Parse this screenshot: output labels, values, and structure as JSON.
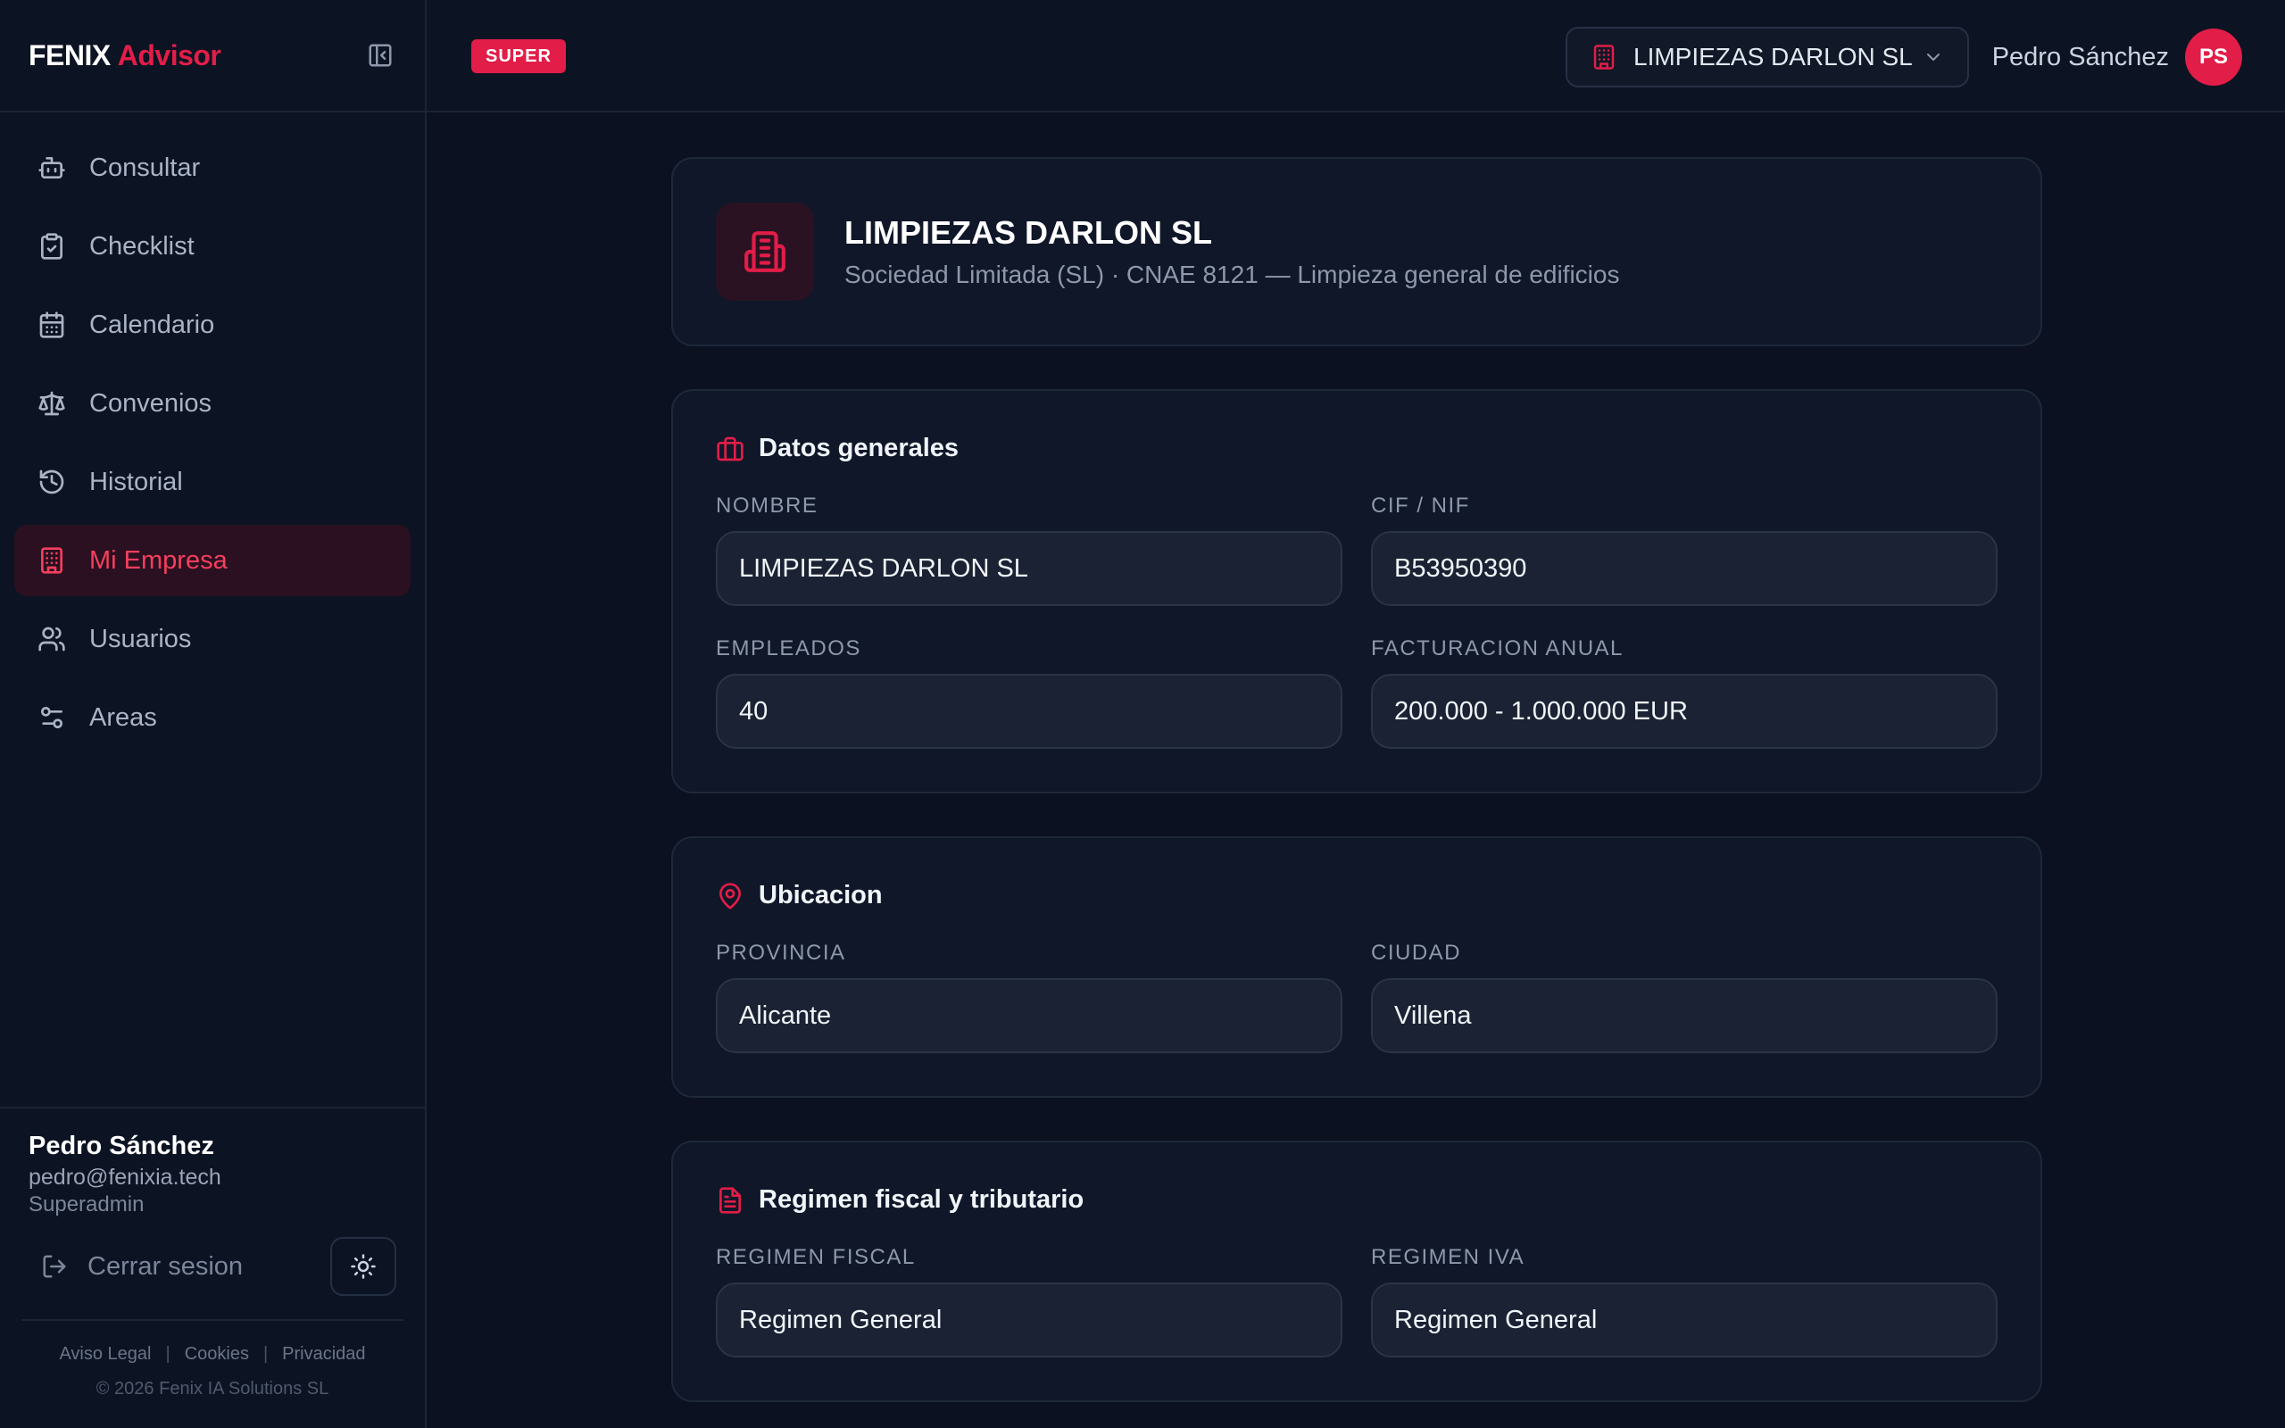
{
  "brand": {
    "part1": "FENIX",
    "part2": "Advisor"
  },
  "sidebar": {
    "items": [
      {
        "label": "Consultar"
      },
      {
        "label": "Checklist"
      },
      {
        "label": "Calendario"
      },
      {
        "label": "Convenios"
      },
      {
        "label": "Historial"
      },
      {
        "label": "Mi Empresa",
        "active": true
      },
      {
        "label": "Usuarios"
      },
      {
        "label": "Areas"
      }
    ],
    "user": {
      "name": "Pedro Sánchez",
      "email": "pedro@fenixia.tech",
      "role": "Superadmin"
    },
    "logout_label": "Cerrar sesion",
    "legal": {
      "aviso": "Aviso Legal",
      "cookies": "Cookies",
      "privacidad": "Privacidad"
    },
    "copyright": "© 2026 Fenix IA Solutions SL"
  },
  "topbar": {
    "badge": "SUPER",
    "company": "LIMPIEZAS DARLON SL",
    "user_name": "Pedro Sánchez",
    "user_initials": "PS"
  },
  "company": {
    "name": "LIMPIEZAS DARLON SL",
    "subtitle": "Sociedad Limitada (SL) · CNAE 8121 — Limpieza general de edificios"
  },
  "sections": {
    "general": {
      "title": "Datos generales",
      "nombre_label": "NOMBRE",
      "nombre": "LIMPIEZAS DARLON SL",
      "cif_label": "CIF / NIF",
      "cif": "B53950390",
      "empleados_label": "EMPLEADOS",
      "empleados": "40",
      "facturacion_label": "FACTURACION ANUAL",
      "facturacion": "200.000 - 1.000.000 EUR"
    },
    "ubicacion": {
      "title": "Ubicacion",
      "provincia_label": "PROVINCIA",
      "provincia": "Alicante",
      "ciudad_label": "CIUDAD",
      "ciudad": "Villena"
    },
    "fiscal": {
      "title": "Regimen fiscal y tributario",
      "fiscal_label": "REGIMEN FISCAL",
      "fiscal": "Regimen General",
      "iva_label": "REGIMEN IVA",
      "iva": "Regimen General"
    }
  },
  "colors": {
    "accent": "#e11d48",
    "background": "#0b1120",
    "card": "#0f1729"
  },
  "icons": [
    "panel-collapse-icon",
    "bot-icon",
    "clipboard-check-icon",
    "calendar-icon",
    "scale-icon",
    "history-icon",
    "building-icon",
    "users-icon",
    "sliders-icon",
    "logout-icon",
    "sun-icon",
    "chevron-down-icon",
    "briefcase-icon",
    "map-pin-icon",
    "file-text-icon"
  ]
}
